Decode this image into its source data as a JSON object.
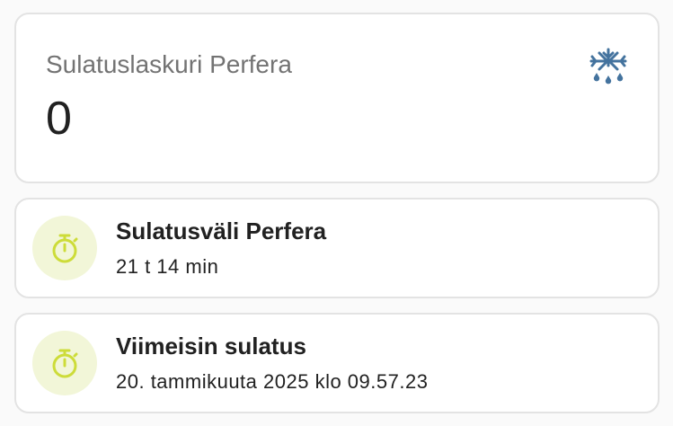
{
  "sensor_card": {
    "name": "Sulatuslaskuri Perfera",
    "value": "0",
    "icon": "snowflake-melt-icon",
    "icon_color": "#44739e"
  },
  "tiles": [
    {
      "title": "Sulatusväli Perfera",
      "state": "21 t 14 min",
      "icon": "timer-icon",
      "icon_color": "#cddc39"
    },
    {
      "title": "Viimeisin sulatus",
      "state": "20. tammikuuta 2025 klo 09.57.23",
      "icon": "timer-icon",
      "icon_color": "#cddc39"
    }
  ]
}
